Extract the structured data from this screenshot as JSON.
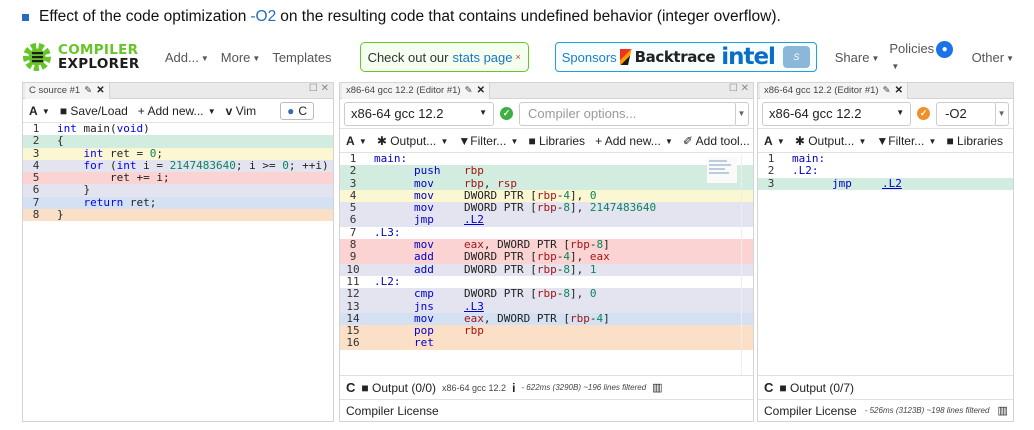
{
  "caption": {
    "before": "Effect of the code optimization",
    "flag": "-O2",
    "after": "on the resulting code that contains undefined behavior (integer overflow)."
  },
  "colors": {
    "green": "#67c52a",
    "blue": "#1a73c8",
    "hl_green": "#d2ecdf",
    "hl_yellow": "#fbf7d3",
    "hl_red": "#fbd3d3",
    "hl_lavender": "#e4e4f1",
    "hl_blue": "#d4e1f2",
    "hl_orange": "#fbe0c7"
  },
  "header": {
    "logo_line1": "COMPILER",
    "logo_line2": "EXPLORER",
    "menu": [
      "Add...",
      "More",
      "Templates"
    ],
    "stats_text": "Check out our",
    "stats_link": "stats page",
    "sponsors_label": "Sponsors",
    "backtrace": "Backtrace",
    "intel": "intel",
    "solid": "Solid Sands",
    "right_menu": [
      "Share",
      "Policies",
      "Other"
    ]
  },
  "source": {
    "tab_title": "C source #1",
    "toolbar": {
      "font": "A",
      "save": "Save/Load",
      "add": "+ Add new...",
      "vim": "Vim",
      "lang": "C"
    },
    "lines": [
      {
        "n": "1",
        "hl": "",
        "t": "int main(void)"
      },
      {
        "n": "2",
        "hl": "hl_green",
        "t": "{"
      },
      {
        "n": "3",
        "hl": "hl_yellow",
        "t": "    int ret = 0;"
      },
      {
        "n": "4",
        "hl": "hl_lavender",
        "t": "    for (int i = 2147483640; i >= 0; ++i) {"
      },
      {
        "n": "5",
        "hl": "hl_red",
        "t": "        ret += i;"
      },
      {
        "n": "6",
        "hl": "hl_lavender",
        "t": "    }"
      },
      {
        "n": "7",
        "hl": "hl_blue",
        "t": "    return ret;"
      },
      {
        "n": "8",
        "hl": "hl_orange",
        "t": "}"
      }
    ]
  },
  "asm1": {
    "tab_title": "x86-64 gcc 12.2 (Editor #1)",
    "compiler": "x86-64 gcc 12.2",
    "options_placeholder": "Compiler options...",
    "toolbar": [
      "Output...",
      "Filter...",
      "Libraries",
      "+ Add new...",
      "Add tool..."
    ],
    "lines": [
      {
        "n": "1",
        "hl": "",
        "label": "main:",
        "ins": "",
        "ops": ""
      },
      {
        "n": "2",
        "hl": "hl_green",
        "label": "",
        "ins": "push",
        "ops": "rbp"
      },
      {
        "n": "3",
        "hl": "hl_green",
        "label": "",
        "ins": "mov",
        "ops": "rbp, rsp"
      },
      {
        "n": "4",
        "hl": "hl_yellow",
        "label": "",
        "ins": "mov",
        "ops": "DWORD PTR [rbp-4], 0"
      },
      {
        "n": "5",
        "hl": "hl_lavender",
        "label": "",
        "ins": "mov",
        "ops": "DWORD PTR [rbp-8], 2147483640"
      },
      {
        "n": "6",
        "hl": "hl_lavender",
        "label": "",
        "ins": "jmp",
        "ops": ".L2"
      },
      {
        "n": "7",
        "hl": "",
        "label": ".L3:",
        "ins": "",
        "ops": ""
      },
      {
        "n": "8",
        "hl": "hl_red",
        "label": "",
        "ins": "mov",
        "ops": "eax, DWORD PTR [rbp-8]"
      },
      {
        "n": "9",
        "hl": "hl_red",
        "label": "",
        "ins": "add",
        "ops": "DWORD PTR [rbp-4], eax"
      },
      {
        "n": "10",
        "hl": "hl_lavender",
        "label": "",
        "ins": "add",
        "ops": "DWORD PTR [rbp-8], 1"
      },
      {
        "n": "11",
        "hl": "",
        "label": ".L2:",
        "ins": "",
        "ops": ""
      },
      {
        "n": "12",
        "hl": "hl_lavender",
        "label": "",
        "ins": "cmp",
        "ops": "DWORD PTR [rbp-8], 0"
      },
      {
        "n": "13",
        "hl": "hl_lavender",
        "label": "",
        "ins": "jns",
        "ops": ".L3"
      },
      {
        "n": "14",
        "hl": "hl_blue",
        "label": "",
        "ins": "mov",
        "ops": "eax, DWORD PTR [rbp-4]"
      },
      {
        "n": "15",
        "hl": "hl_orange",
        "label": "",
        "ins": "pop",
        "ops": "rbp"
      },
      {
        "n": "16",
        "hl": "hl_orange",
        "label": "",
        "ins": "ret",
        "ops": ""
      }
    ],
    "output": "Output (0/0)",
    "compiler_small": "x86-64 gcc 12.2",
    "stats": "- 622ms (3290B) ~196 lines filtered",
    "license": "Compiler License"
  },
  "asm2": {
    "tab_title": "x86-64 gcc 12.2 (Editor #1)",
    "compiler": "x86-64 gcc 12.2",
    "options": "-O2",
    "toolbar": [
      "Output...",
      "Filter...",
      "Libraries"
    ],
    "lines": [
      {
        "n": "1",
        "hl": "",
        "label": "main:",
        "ins": "",
        "ops": ""
      },
      {
        "n": "2",
        "hl": "",
        "label": ".L2:",
        "ins": "",
        "ops": ""
      },
      {
        "n": "3",
        "hl": "hl_green",
        "label": "",
        "ins": "jmp",
        "ops": ".L2"
      }
    ],
    "output": "Output (0/7)",
    "license": "Compiler License",
    "stats": "- 526ms (3123B) ~198 lines filtered"
  }
}
